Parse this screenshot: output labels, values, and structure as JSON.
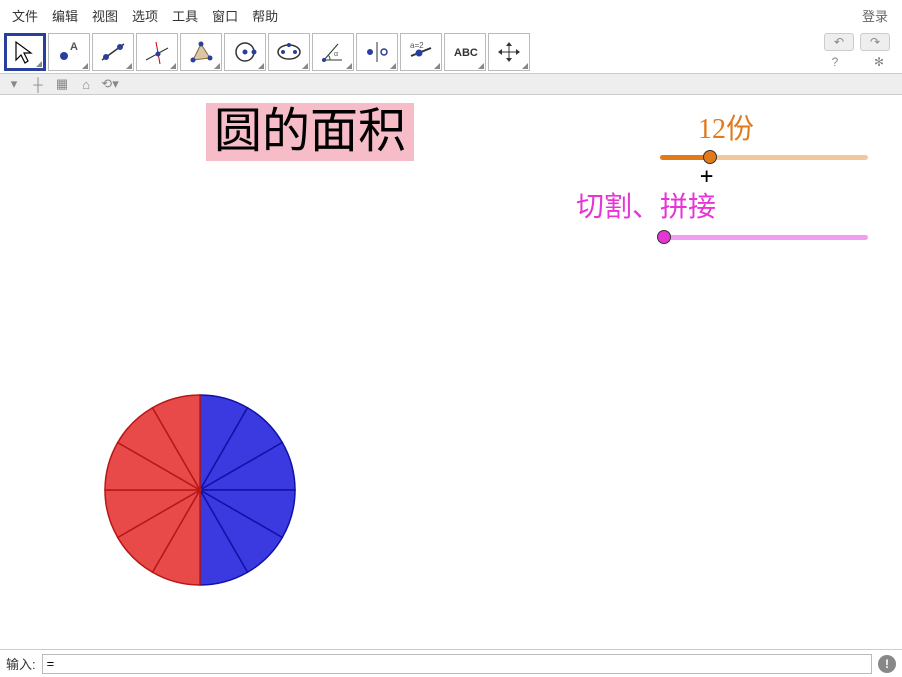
{
  "menu": {
    "file": "文件",
    "edit": "编辑",
    "view": "视图",
    "options": "选项",
    "tools": "工具",
    "window": "窗口",
    "help": "帮助",
    "login": "登录"
  },
  "toolbar": {
    "tools": [
      {
        "name": "move-tool",
        "active": true
      },
      {
        "name": "point-tool"
      },
      {
        "name": "line-tool"
      },
      {
        "name": "perpendicular-tool"
      },
      {
        "name": "polygon-tool"
      },
      {
        "name": "circle-tool"
      },
      {
        "name": "ellipse-tool"
      },
      {
        "name": "angle-tool"
      },
      {
        "name": "reflect-tool"
      },
      {
        "name": "slider-tool"
      },
      {
        "name": "text-tool",
        "label": "ABC"
      },
      {
        "name": "move-view-tool"
      }
    ]
  },
  "canvas": {
    "title": "圆的面积",
    "slider1": {
      "label": "12份",
      "value": 12,
      "min": 0,
      "max": 48,
      "pos_pct": 24
    },
    "slider2": {
      "label": "切割、拼接",
      "value": 0,
      "min": 0,
      "max": 1,
      "pos_pct": 0
    },
    "plus": "+",
    "pie": {
      "slices": 12,
      "colors": {
        "left": "#e84a4a",
        "right": "#3a3ae0",
        "stroke_left": "#b91616",
        "stroke_right": "#1111a8"
      }
    }
  },
  "input": {
    "label": "输入:",
    "value": "="
  },
  "chart_data": {
    "type": "pie",
    "title": "圆的面积",
    "slices": 12,
    "values": [
      1,
      1,
      1,
      1,
      1,
      1,
      1,
      1,
      1,
      1,
      1,
      1
    ],
    "colors": [
      "#3a3ae0",
      "#3a3ae0",
      "#3a3ae0",
      "#e84a4a",
      "#e84a4a",
      "#e84a4a",
      "#e84a4a",
      "#e84a4a",
      "#e84a4a",
      "#3a3ae0",
      "#3a3ae0",
      "#3a3ae0"
    ],
    "sliders": [
      {
        "name": "份",
        "label": "12份",
        "value": 12
      },
      {
        "name": "切割、拼接",
        "label": "切割、拼接",
        "value": 0
      }
    ]
  }
}
